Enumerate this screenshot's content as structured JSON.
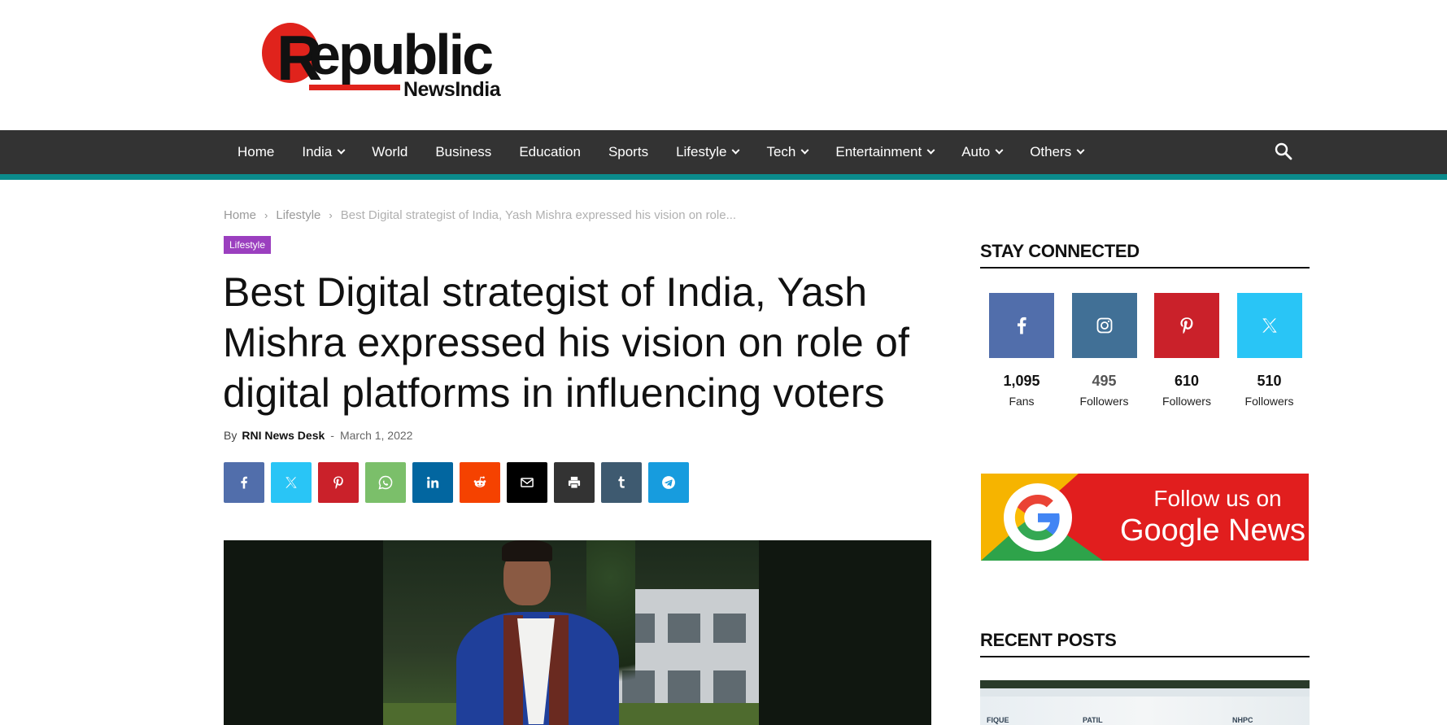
{
  "logo": {
    "r_letter": "R",
    "main": "epublic",
    "sub_prefix": "News",
    "sub_suffix": "India",
    "brand_red": "#e0231c"
  },
  "nav": {
    "items": [
      {
        "label": "Home",
        "dropdown": false
      },
      {
        "label": "India",
        "dropdown": true
      },
      {
        "label": "World",
        "dropdown": false
      },
      {
        "label": "Business",
        "dropdown": false
      },
      {
        "label": "Education",
        "dropdown": false
      },
      {
        "label": "Sports",
        "dropdown": false
      },
      {
        "label": "Lifestyle",
        "dropdown": true
      },
      {
        "label": "Tech",
        "dropdown": true
      },
      {
        "label": "Entertainment",
        "dropdown": true
      },
      {
        "label": "Auto",
        "dropdown": true
      },
      {
        "label": "Others",
        "dropdown": true
      }
    ],
    "search_icon": "search-icon",
    "bar_color": "#333333",
    "accent_color": "#0b8b8c"
  },
  "breadcrumb": {
    "home": "Home",
    "category": "Lifestyle",
    "current": "Best Digital strategist of India, Yash Mishra expressed his vision on role...",
    "separator": "›"
  },
  "article": {
    "category_badge": "Lifestyle",
    "badge_color": "#9b3fbf",
    "title": "Best Digital strategist of India, Yash Mishra expressed his vision on role of digital platforms in influencing voters",
    "by": "By",
    "author": "RNI News Desk",
    "dash": "-",
    "date": "March 1, 2022"
  },
  "share": {
    "buttons": [
      {
        "name": "facebook",
        "icon": "facebook-icon",
        "color": "#516eab"
      },
      {
        "name": "twitter",
        "icon": "x-icon",
        "color": "#29c5f6"
      },
      {
        "name": "pinterest",
        "icon": "pinterest-icon",
        "color": "#ca212a"
      },
      {
        "name": "whatsapp",
        "icon": "whatsapp-icon",
        "color": "#7bbf6a"
      },
      {
        "name": "linkedin",
        "icon": "linkedin-icon",
        "color": "#0266a0"
      },
      {
        "name": "reddit",
        "icon": "reddit-icon",
        "color": "#f54200"
      },
      {
        "name": "email",
        "icon": "mail-icon",
        "color": "#000000"
      },
      {
        "name": "print",
        "icon": "print-icon",
        "color": "#333333"
      },
      {
        "name": "tumblr",
        "icon": "tumblr-icon",
        "color": "#3e5a70"
      },
      {
        "name": "telegram",
        "icon": "telegram-icon",
        "color": "#179cde"
      }
    ]
  },
  "sidebar": {
    "stay_connected_title": "STAY CONNECTED",
    "social": [
      {
        "name": "facebook",
        "icon": "facebook-icon",
        "color": "#516eab",
        "count": "1,095",
        "label": "Fans"
      },
      {
        "name": "instagram",
        "icon": "instagram-icon",
        "color": "#417096",
        "count": "495",
        "label": "Followers"
      },
      {
        "name": "pinterest",
        "icon": "pinterest-icon",
        "color": "#ca212a",
        "count": "610",
        "label": "Followers"
      },
      {
        "name": "twitter",
        "icon": "x-icon",
        "color": "#29c5f6",
        "count": "510",
        "label": "Followers"
      }
    ],
    "google_news": {
      "line1": "Follow us on",
      "line2": "Google News",
      "icon": "google-icon"
    },
    "recent_posts_title": "RECENT POSTS",
    "recent_thumb_texts": [
      "FIQUE",
      "PATIL",
      "NHPC"
    ]
  }
}
